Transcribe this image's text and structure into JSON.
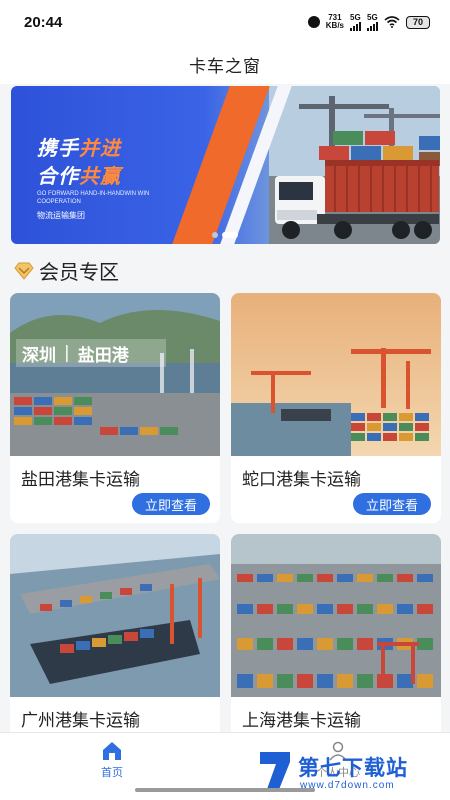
{
  "status_bar": {
    "time": "20:44",
    "net_speed": "731",
    "net_unit": "KB/s",
    "signal1_label": "5G",
    "signal2_label": "5G",
    "battery": "70"
  },
  "header": {
    "title": "卡车之窗"
  },
  "banner": {
    "headline1_a": "携手",
    "headline1_b": "并进",
    "headline2_a": "合作",
    "headline2_b": "共赢",
    "english": "GO FORWARD HAND-IN-HANDWIN WIN COOPERATION",
    "company": "物流运输集团",
    "slides": 2,
    "active_slide": 1
  },
  "section": {
    "title": "会员专区"
  },
  "cards": [
    {
      "title": "盐田港集卡运输",
      "button": "立即查看",
      "image_tag_a": "深圳",
      "image_tag_b": "盐田港"
    },
    {
      "title": "蛇口港集卡运输",
      "button": "立即查看"
    },
    {
      "title": "广州港集卡运输"
    },
    {
      "title": "上海港集卡运输"
    }
  ],
  "tabbar": {
    "home_label": "首页",
    "user_label": "个人中心"
  },
  "watermark": {
    "title": "第七下载站",
    "url": "www.d7down.com"
  },
  "colors": {
    "accent": "#2f6fe0",
    "banner_orange": "#f06a2b",
    "banner_blue": "#2d52d9"
  }
}
